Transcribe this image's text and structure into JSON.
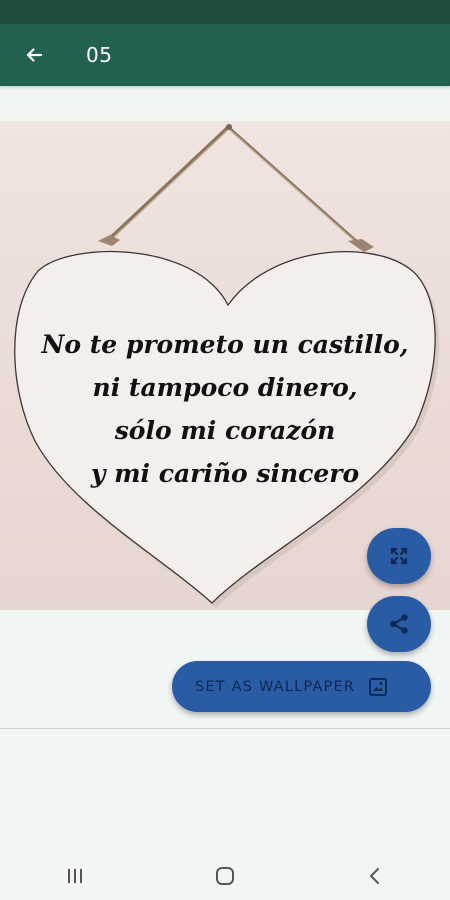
{
  "app_bar": {
    "title": "05",
    "back_icon": "arrow-left-icon",
    "background_color": "#22614f"
  },
  "image": {
    "quote_lines": [
      "No te prometo un castillo,",
      "ni tampoco dinero,",
      "sólo mi corazón",
      "y mi cariño sincero"
    ]
  },
  "actions": {
    "expand_icon": "fullscreen-icon",
    "share_icon": "share-icon",
    "set_wallpaper_label": "SET AS WALLPAPER",
    "set_wallpaper_icon": "wallpaper-icon",
    "accent_color": "#2a5ca5"
  },
  "system_nav": {
    "recents_icon": "recents-icon",
    "home_icon": "home-icon",
    "back_icon": "back-chevron-icon"
  }
}
